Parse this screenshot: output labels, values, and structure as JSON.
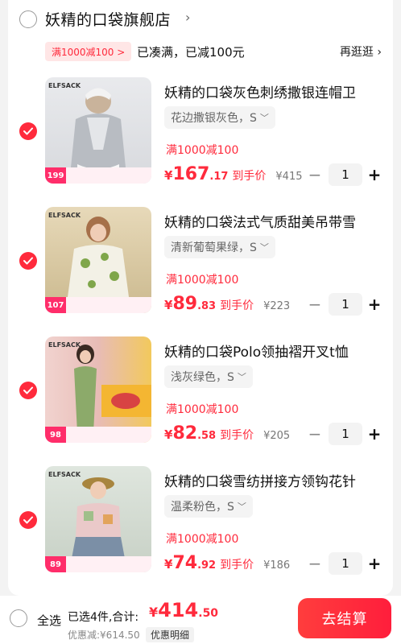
{
  "shop": {
    "name": "妖精的口袋旗舰店",
    "promo_tag": "满1000减100 >",
    "promo_text": "已凑满，已减100元",
    "more_link": "再逛逛 ›"
  },
  "items": [
    {
      "title": "妖精的口袋灰色刺绣撒银连帽卫",
      "sku": "花边撒银灰色，S",
      "discount": "满1000减100",
      "price_sym": "¥",
      "price_int": "167",
      "price_dec": ".17",
      "price_label": "到手价",
      "orig_price": "¥415",
      "qty": "1",
      "thumb_price": "199"
    },
    {
      "title": "妖精的口袋法式气质甜美吊带雪",
      "sku": "清新葡萄果绿，S",
      "discount": "满1000减100",
      "price_sym": "¥",
      "price_int": "89",
      "price_dec": ".83",
      "price_label": "到手价",
      "orig_price": "¥223",
      "qty": "1",
      "thumb_price": "107"
    },
    {
      "title": "妖精的口袋Polo领抽褶开叉t恤",
      "sku": "浅灰绿色，S",
      "discount": "满1000减100",
      "price_sym": "¥",
      "price_int": "82",
      "price_dec": ".58",
      "price_label": "到手价",
      "orig_price": "¥205",
      "qty": "1",
      "thumb_price": "98"
    },
    {
      "title": "妖精的口袋雪纺拼接方领钩花针",
      "sku": "温柔粉色，S",
      "discount": "满1000减100",
      "price_sym": "¥",
      "price_int": "74",
      "price_dec": ".92",
      "price_label": "到手价",
      "orig_price": "¥186",
      "qty": "1",
      "thumb_price": "89"
    }
  ],
  "stepper": {
    "minus": "−",
    "plus": "+"
  },
  "bottom": {
    "select_all": "全选",
    "selected": "已选4件,合计:",
    "total_sym": "¥",
    "total_int": "414",
    "total_dec": ".50",
    "saved": "优惠减:¥614.50",
    "detail": "优惠明细",
    "checkout": "去结算"
  },
  "colors": {
    "accent": "#ff2a3c",
    "promo_bg": "#ffe6e6"
  },
  "icons": {
    "check": "checkmark-circle-icon",
    "chevron": "chevron-right-icon"
  }
}
